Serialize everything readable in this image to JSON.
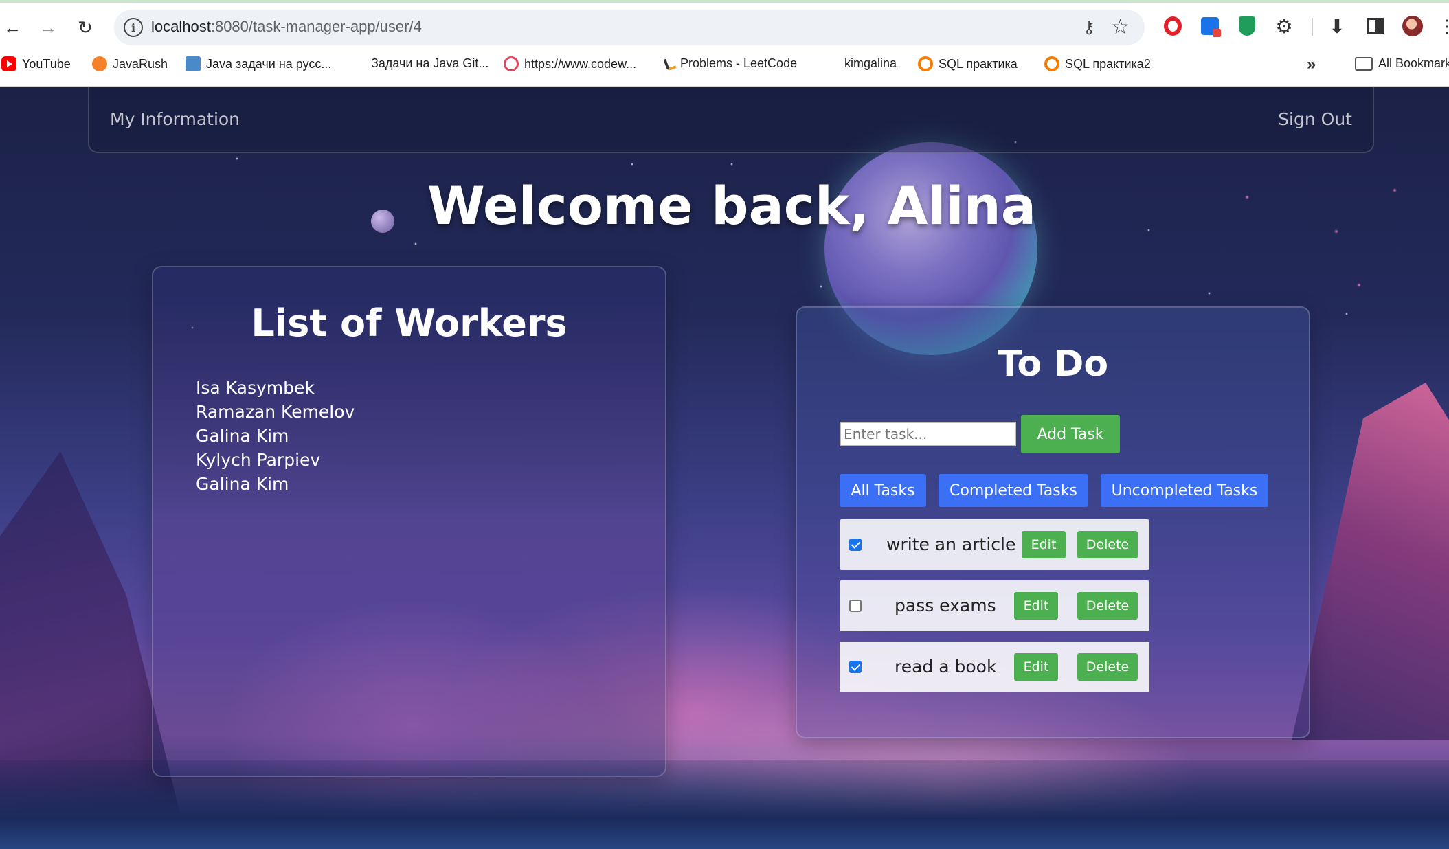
{
  "browser": {
    "url_host": "localhost",
    "url_path": ":8080/task-manager-app/user/4",
    "bookmarks": [
      {
        "label": "YouTube",
        "icon": "youtube-icon"
      },
      {
        "label": "JavaRush",
        "icon": "javarush-icon"
      },
      {
        "label": "Java задачи на русс...",
        "icon": "java-tasks-icon"
      },
      {
        "label": "Задачи на Java Git...",
        "icon": ""
      },
      {
        "label": "https://www.codew...",
        "icon": "codewars-icon"
      },
      {
        "label": "Problems - LeetCode",
        "icon": "leetcode-icon"
      },
      {
        "label": "kimgalina",
        "icon": ""
      },
      {
        "label": "SQL  практика",
        "icon": "sql-icon"
      },
      {
        "label": "SQL практика2",
        "icon": "sql-icon"
      }
    ],
    "all_bookmarks_label": "All Bookmarks"
  },
  "navbar": {
    "my_information": "My Information",
    "sign_out": "Sign Out"
  },
  "welcome": "Welcome back, Alina",
  "workers": {
    "title": "List of Workers",
    "items": [
      "Isa Kasymbek",
      "Ramazan Kemelov",
      "Galina Kim",
      "Kylych Parpiev",
      "Galina Kim"
    ]
  },
  "todo": {
    "title": "To Do",
    "input_placeholder": "Enter task...",
    "add_label": "Add Task",
    "filters": {
      "all": "All Tasks",
      "completed": "Completed Tasks",
      "uncompleted": "Uncompleted Tasks"
    },
    "edit_label": "Edit",
    "delete_label": "Delete",
    "tasks": [
      {
        "text": "write an article",
        "completed": true
      },
      {
        "text": "pass exams",
        "completed": false
      },
      {
        "text": "read a book",
        "completed": true
      }
    ]
  },
  "colors": {
    "accent_green": "#4caf50",
    "accent_blue": "#3b6ff5"
  }
}
